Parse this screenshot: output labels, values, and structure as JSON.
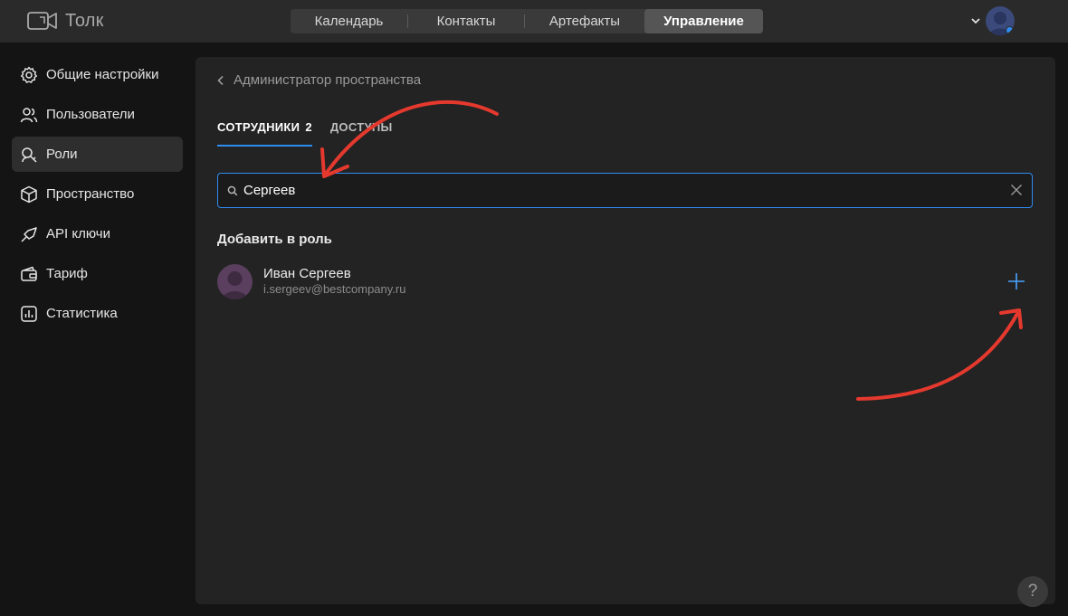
{
  "app": {
    "name": "Толк"
  },
  "nav": {
    "items": [
      {
        "label": "Календарь"
      },
      {
        "label": "Контакты"
      },
      {
        "label": "Артефакты"
      },
      {
        "label": "Управление"
      }
    ],
    "active": "Управление"
  },
  "sidebar": {
    "items": [
      {
        "label": "Общие настройки",
        "icon": "gear-icon"
      },
      {
        "label": "Пользователи",
        "icon": "users-icon"
      },
      {
        "label": "Роли",
        "icon": "roles-icon"
      },
      {
        "label": "Пространство",
        "icon": "cube-icon"
      },
      {
        "label": "API ключи",
        "icon": "key-icon"
      },
      {
        "label": "Тариф",
        "icon": "wallet-icon"
      },
      {
        "label": "Статистика",
        "icon": "chart-icon"
      }
    ],
    "active": "Роли"
  },
  "main": {
    "breadcrumb": "Администратор пространства",
    "tabs": [
      {
        "label": "СОТРУДНИКИ",
        "count": "2"
      },
      {
        "label": "ДОСТУПЫ"
      }
    ],
    "search": {
      "value": "Сергеев"
    },
    "section_title": "Добавить в роль",
    "people": [
      {
        "name": "Иван Сергеев",
        "email": "i.sergeev@bestcompany.ru"
      }
    ]
  },
  "help": {
    "label": "?"
  },
  "colors": {
    "accent": "#2f8cf0",
    "annotation": "#e5392e",
    "background": "#141414",
    "panel": "#232323"
  }
}
